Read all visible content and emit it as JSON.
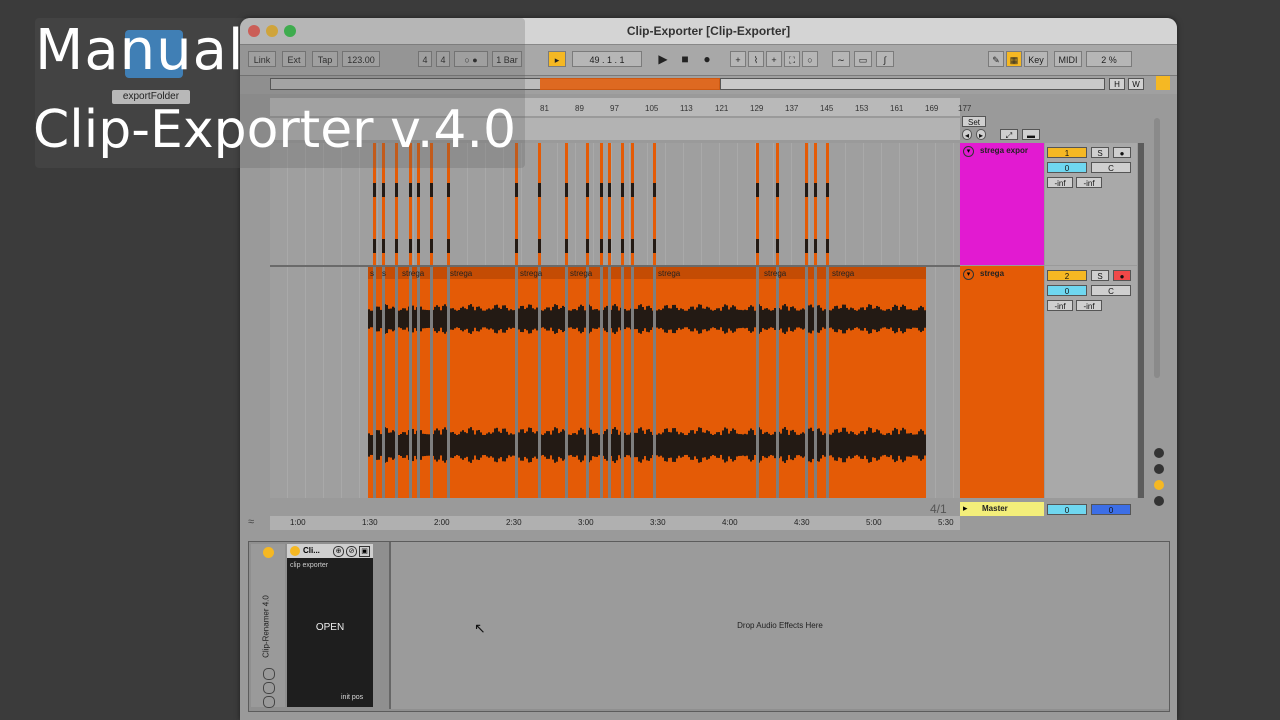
{
  "overlay": {
    "line1": "Manual",
    "line2": "Clip-Exporter v.4.0",
    "folder_label": "exportFolder"
  },
  "window": {
    "title": "Clip-Exporter  [Clip-Exporter]"
  },
  "toolbar": {
    "link": "Link",
    "ext": "Ext",
    "tap": "Tap",
    "tempo": "123.00",
    "sig_num": "4",
    "sig_den": "4",
    "metronome": "○ ●",
    "quantize": "1 Bar",
    "position": "49 .   1 .   1",
    "key_label": "Key",
    "midi_label": "MIDI",
    "cpu": "2 %"
  },
  "overview_buttons": [
    "H",
    "W"
  ],
  "ruler_marks": [
    "81",
    "89",
    "97",
    "105",
    "113",
    "121",
    "129",
    "137",
    "145",
    "153",
    "161",
    "169",
    "177"
  ],
  "set_label": "Set",
  "tracks": [
    {
      "name": "strega expor",
      "number": "1",
      "solo": "S",
      "volume": "0",
      "pan": "C",
      "meter_l": "-inf",
      "meter_r": "-inf",
      "color": "#e21ad1"
    },
    {
      "name": "strega",
      "number": "2",
      "solo": "S",
      "volume": "0",
      "pan": "C",
      "meter_l": "-inf",
      "meter_r": "-inf",
      "color": "#e45b06"
    }
  ],
  "clip_labels": [
    "s",
    "s",
    "strega",
    "strega",
    "strega",
    "strega",
    "strega",
    "strega",
    "strega"
  ],
  "master": {
    "name": "Master",
    "volume": "0",
    "pan": "0"
  },
  "loop_display": "4/1",
  "time_marks": [
    "1:00",
    "1:30",
    "2:00",
    "2:30",
    "3:00",
    "3:30",
    "4:00",
    "4:30",
    "5:00",
    "5:30"
  ],
  "device": {
    "rack_name": "Clip-Renamer  4.0",
    "plugin_title": "Cli...",
    "plugin_subtitle": "clip exporter",
    "open_button": "OPEN",
    "init_pos": "init pos",
    "drop_text": "Drop Audio Effects Here"
  },
  "colors": {
    "orange": "#e45b06",
    "magenta": "#e21ad1",
    "yellow": "#f5b823",
    "cyan": "#6fd7f0",
    "blue": "#3c6ee6",
    "master_yellow": "#f3ee7a"
  }
}
